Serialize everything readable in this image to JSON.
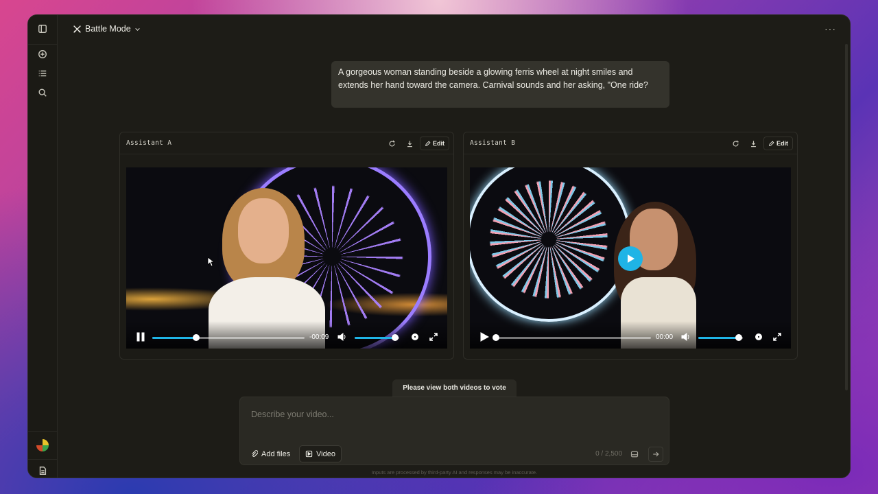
{
  "header": {
    "mode_label": "Battle Mode",
    "more_label": "···"
  },
  "prompt": {
    "text": "A gorgeous woman standing beside a glowing ferris wheel at night smiles and extends her hand toward the camera. Carnival sounds and her asking, \"One ride?"
  },
  "assistant_a": {
    "title": "Assistant A",
    "edit_label": "Edit",
    "time": "-00:09",
    "progress": 0.29,
    "volume": 0.9,
    "state": "playing"
  },
  "assistant_b": {
    "title": "Assistant B",
    "edit_label": "Edit",
    "time": "00:00",
    "progress": 0.0,
    "volume": 0.9,
    "state": "paused"
  },
  "vote": {
    "tip": "Please view both videos to vote"
  },
  "composer": {
    "placeholder": "Describe your video...",
    "add_files_label": "Add files",
    "video_label": "Video",
    "counter": "0 / 2,500"
  },
  "footer": {
    "disclaimer": "Inputs are processed by third-party AI and responses may be inaccurate."
  },
  "icons": {
    "sidebar": [
      "sidebar-toggle-icon",
      "new-chat-icon",
      "list-icon",
      "search-icon",
      "avatar",
      "document-icon"
    ]
  },
  "colors": {
    "accent": "#1fb4e6",
    "background": "#1d1c17"
  }
}
